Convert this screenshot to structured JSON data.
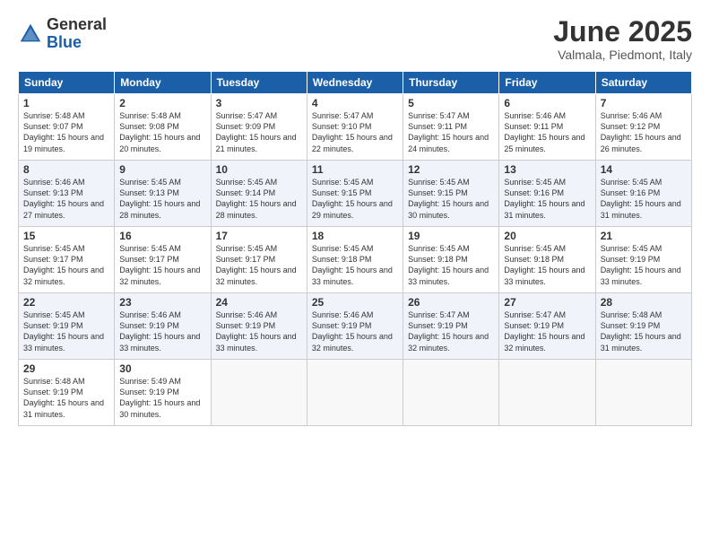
{
  "logo": {
    "general": "General",
    "blue": "Blue"
  },
  "title": "June 2025",
  "subtitle": "Valmala, Piedmont, Italy",
  "headers": [
    "Sunday",
    "Monday",
    "Tuesday",
    "Wednesday",
    "Thursday",
    "Friday",
    "Saturday"
  ],
  "weeks": [
    [
      {
        "day": "1",
        "info": "Sunrise: 5:48 AM\nSunset: 9:07 PM\nDaylight: 15 hours\nand 19 minutes."
      },
      {
        "day": "2",
        "info": "Sunrise: 5:48 AM\nSunset: 9:08 PM\nDaylight: 15 hours\nand 20 minutes."
      },
      {
        "day": "3",
        "info": "Sunrise: 5:47 AM\nSunset: 9:09 PM\nDaylight: 15 hours\nand 21 minutes."
      },
      {
        "day": "4",
        "info": "Sunrise: 5:47 AM\nSunset: 9:10 PM\nDaylight: 15 hours\nand 22 minutes."
      },
      {
        "day": "5",
        "info": "Sunrise: 5:47 AM\nSunset: 9:11 PM\nDaylight: 15 hours\nand 24 minutes."
      },
      {
        "day": "6",
        "info": "Sunrise: 5:46 AM\nSunset: 9:11 PM\nDaylight: 15 hours\nand 25 minutes."
      },
      {
        "day": "7",
        "info": "Sunrise: 5:46 AM\nSunset: 9:12 PM\nDaylight: 15 hours\nand 26 minutes."
      }
    ],
    [
      {
        "day": "8",
        "info": "Sunrise: 5:46 AM\nSunset: 9:13 PM\nDaylight: 15 hours\nand 27 minutes."
      },
      {
        "day": "9",
        "info": "Sunrise: 5:45 AM\nSunset: 9:13 PM\nDaylight: 15 hours\nand 28 minutes."
      },
      {
        "day": "10",
        "info": "Sunrise: 5:45 AM\nSunset: 9:14 PM\nDaylight: 15 hours\nand 28 minutes."
      },
      {
        "day": "11",
        "info": "Sunrise: 5:45 AM\nSunset: 9:15 PM\nDaylight: 15 hours\nand 29 minutes."
      },
      {
        "day": "12",
        "info": "Sunrise: 5:45 AM\nSunset: 9:15 PM\nDaylight: 15 hours\nand 30 minutes."
      },
      {
        "day": "13",
        "info": "Sunrise: 5:45 AM\nSunset: 9:16 PM\nDaylight: 15 hours\nand 31 minutes."
      },
      {
        "day": "14",
        "info": "Sunrise: 5:45 AM\nSunset: 9:16 PM\nDaylight: 15 hours\nand 31 minutes."
      }
    ],
    [
      {
        "day": "15",
        "info": "Sunrise: 5:45 AM\nSunset: 9:17 PM\nDaylight: 15 hours\nand 32 minutes."
      },
      {
        "day": "16",
        "info": "Sunrise: 5:45 AM\nSunset: 9:17 PM\nDaylight: 15 hours\nand 32 minutes."
      },
      {
        "day": "17",
        "info": "Sunrise: 5:45 AM\nSunset: 9:17 PM\nDaylight: 15 hours\nand 32 minutes."
      },
      {
        "day": "18",
        "info": "Sunrise: 5:45 AM\nSunset: 9:18 PM\nDaylight: 15 hours\nand 33 minutes."
      },
      {
        "day": "19",
        "info": "Sunrise: 5:45 AM\nSunset: 9:18 PM\nDaylight: 15 hours\nand 33 minutes."
      },
      {
        "day": "20",
        "info": "Sunrise: 5:45 AM\nSunset: 9:18 PM\nDaylight: 15 hours\nand 33 minutes."
      },
      {
        "day": "21",
        "info": "Sunrise: 5:45 AM\nSunset: 9:19 PM\nDaylight: 15 hours\nand 33 minutes."
      }
    ],
    [
      {
        "day": "22",
        "info": "Sunrise: 5:45 AM\nSunset: 9:19 PM\nDaylight: 15 hours\nand 33 minutes."
      },
      {
        "day": "23",
        "info": "Sunrise: 5:46 AM\nSunset: 9:19 PM\nDaylight: 15 hours\nand 33 minutes."
      },
      {
        "day": "24",
        "info": "Sunrise: 5:46 AM\nSunset: 9:19 PM\nDaylight: 15 hours\nand 33 minutes."
      },
      {
        "day": "25",
        "info": "Sunrise: 5:46 AM\nSunset: 9:19 PM\nDaylight: 15 hours\nand 32 minutes."
      },
      {
        "day": "26",
        "info": "Sunrise: 5:47 AM\nSunset: 9:19 PM\nDaylight: 15 hours\nand 32 minutes."
      },
      {
        "day": "27",
        "info": "Sunrise: 5:47 AM\nSunset: 9:19 PM\nDaylight: 15 hours\nand 32 minutes."
      },
      {
        "day": "28",
        "info": "Sunrise: 5:48 AM\nSunset: 9:19 PM\nDaylight: 15 hours\nand 31 minutes."
      }
    ],
    [
      {
        "day": "29",
        "info": "Sunrise: 5:48 AM\nSunset: 9:19 PM\nDaylight: 15 hours\nand 31 minutes."
      },
      {
        "day": "30",
        "info": "Sunrise: 5:49 AM\nSunset: 9:19 PM\nDaylight: 15 hours\nand 30 minutes."
      },
      {
        "day": "",
        "info": ""
      },
      {
        "day": "",
        "info": ""
      },
      {
        "day": "",
        "info": ""
      },
      {
        "day": "",
        "info": ""
      },
      {
        "day": "",
        "info": ""
      }
    ]
  ]
}
